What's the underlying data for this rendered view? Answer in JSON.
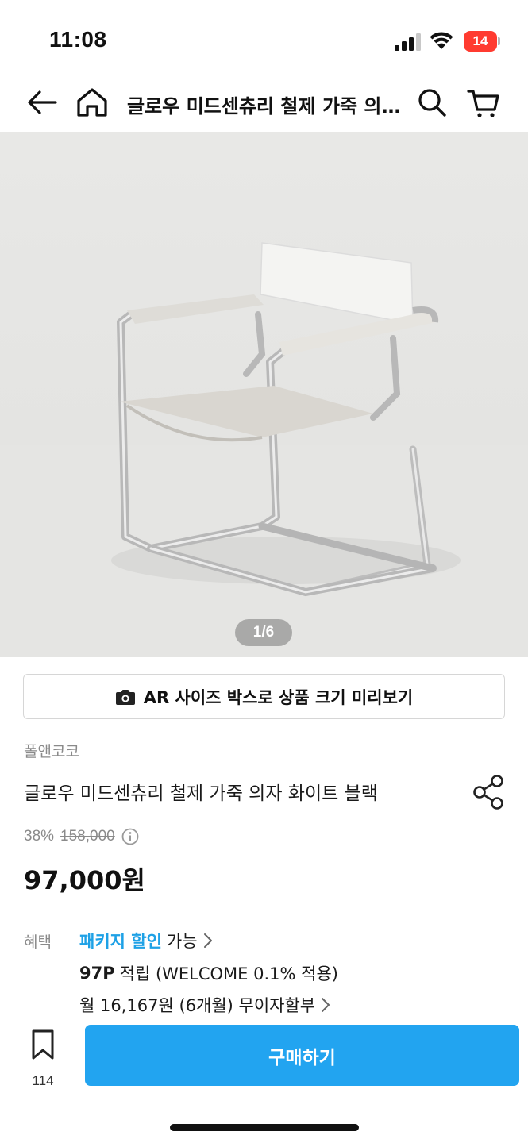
{
  "status_bar": {
    "time": "11:08",
    "battery": "14"
  },
  "nav": {
    "title": "글로우 미드센츄리 철제 가죽 의자 화이트 블랙",
    "icons": [
      "back-arrow-icon",
      "home-icon",
      "search-icon",
      "cart-icon"
    ]
  },
  "gallery": {
    "counter": "1/6"
  },
  "ar": {
    "label": "AR 사이즈 박스로 상품 크기 미리보기",
    "icon": "camera-icon"
  },
  "product": {
    "brand": "폴앤코코",
    "name": "글로우 미드센츄리 철제 가죽 의자 화이트 블랙",
    "discount_rate": "38%",
    "original_price": "158,000",
    "price": "97,000원"
  },
  "benefits": {
    "label": "혜택",
    "package_link": "패키지 할인",
    "package_suffix": "가능",
    "points_value": "97P",
    "points_text": "적립 (WELCOME 0.1% 적용)",
    "installment": "월 16,167원 (6개월) 무이자할부"
  },
  "bottom": {
    "bookmark_count": "114",
    "buy_label": "구매하기"
  },
  "colors": {
    "accent": "#1ea1e6",
    "buy_button": "#22a4f0",
    "battery_low": "#ff3b30"
  }
}
